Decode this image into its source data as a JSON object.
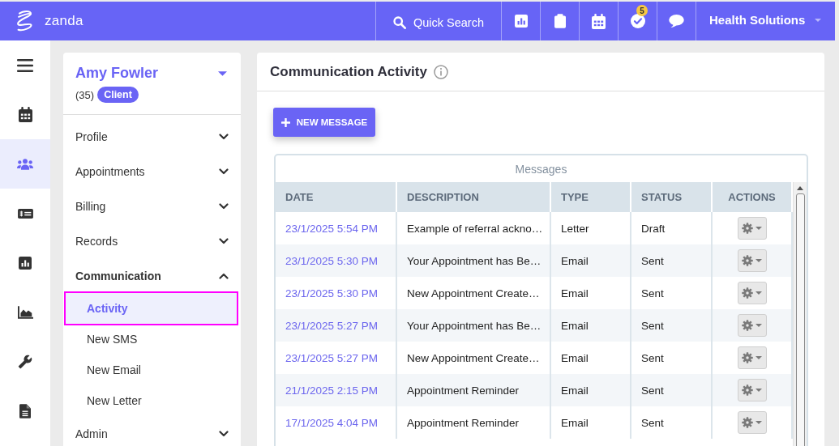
{
  "top_bar": {
    "logo_text": "zanda",
    "quick_search": "Quick Search",
    "icon_buttons": [
      {
        "kind": "bar-chart"
      },
      {
        "kind": "clipboard"
      },
      {
        "kind": "calendar"
      },
      {
        "kind": "check",
        "badge": "5"
      },
      {
        "kind": "chat"
      }
    ],
    "account": "Health Solutions"
  },
  "nav_rail": [
    {
      "kind": "menu",
      "selected": false
    },
    {
      "kind": "calendar",
      "selected": false
    },
    {
      "kind": "people",
      "selected": true
    },
    {
      "kind": "card",
      "selected": false
    },
    {
      "kind": "bar-chart",
      "selected": false
    },
    {
      "kind": "area-chart",
      "selected": false
    },
    {
      "kind": "wrench",
      "selected": false
    },
    {
      "kind": "document",
      "selected": false
    }
  ],
  "client": {
    "name": "Amy Fowler",
    "count": "(35)",
    "badge": "Client"
  },
  "client_menu": [
    {
      "label": "Profile",
      "expanded": false
    },
    {
      "label": "Appointments",
      "expanded": false
    },
    {
      "label": "Billing",
      "expanded": false
    },
    {
      "label": "Records",
      "expanded": false
    },
    {
      "label": "Communication",
      "expanded": true,
      "children": [
        {
          "label": "Activity",
          "selected": true
        },
        {
          "label": "New SMS",
          "selected": false
        },
        {
          "label": "New Email",
          "selected": false
        },
        {
          "label": "New Letter",
          "selected": false
        }
      ]
    },
    {
      "label": "Admin",
      "expanded": false
    }
  ],
  "page": {
    "title": "Communication Activity",
    "new_button": "NEW MESSAGE"
  },
  "messages_table": {
    "caption": "Messages",
    "columns": [
      "DATE",
      "DESCRIPTION",
      "TYPE",
      "STATUS",
      "ACTIONS"
    ],
    "rows": [
      {
        "date": "23/1/2025 5:54 PM",
        "description": "Example of referral ackno…",
        "type": "Letter",
        "status": "Draft"
      },
      {
        "date": "23/1/2025 5:30 PM",
        "description": "Your Appointment has Be…",
        "type": "Email",
        "status": "Sent"
      },
      {
        "date": "23/1/2025 5:30 PM",
        "description": "New Appointment Create…",
        "type": "Email",
        "status": "Sent"
      },
      {
        "date": "23/1/2025 5:27 PM",
        "description": "Your Appointment has Be…",
        "type": "Email",
        "status": "Sent"
      },
      {
        "date": "23/1/2025 5:27 PM",
        "description": "New Appointment Create…",
        "type": "Email",
        "status": "Sent"
      },
      {
        "date": "21/1/2025 2:15 PM",
        "description": "Appointment Reminder",
        "type": "Email",
        "status": "Sent"
      },
      {
        "date": "17/1/2025 4:04 PM",
        "description": "Appointment Reminder",
        "type": "Email",
        "status": "Sent"
      }
    ]
  }
}
